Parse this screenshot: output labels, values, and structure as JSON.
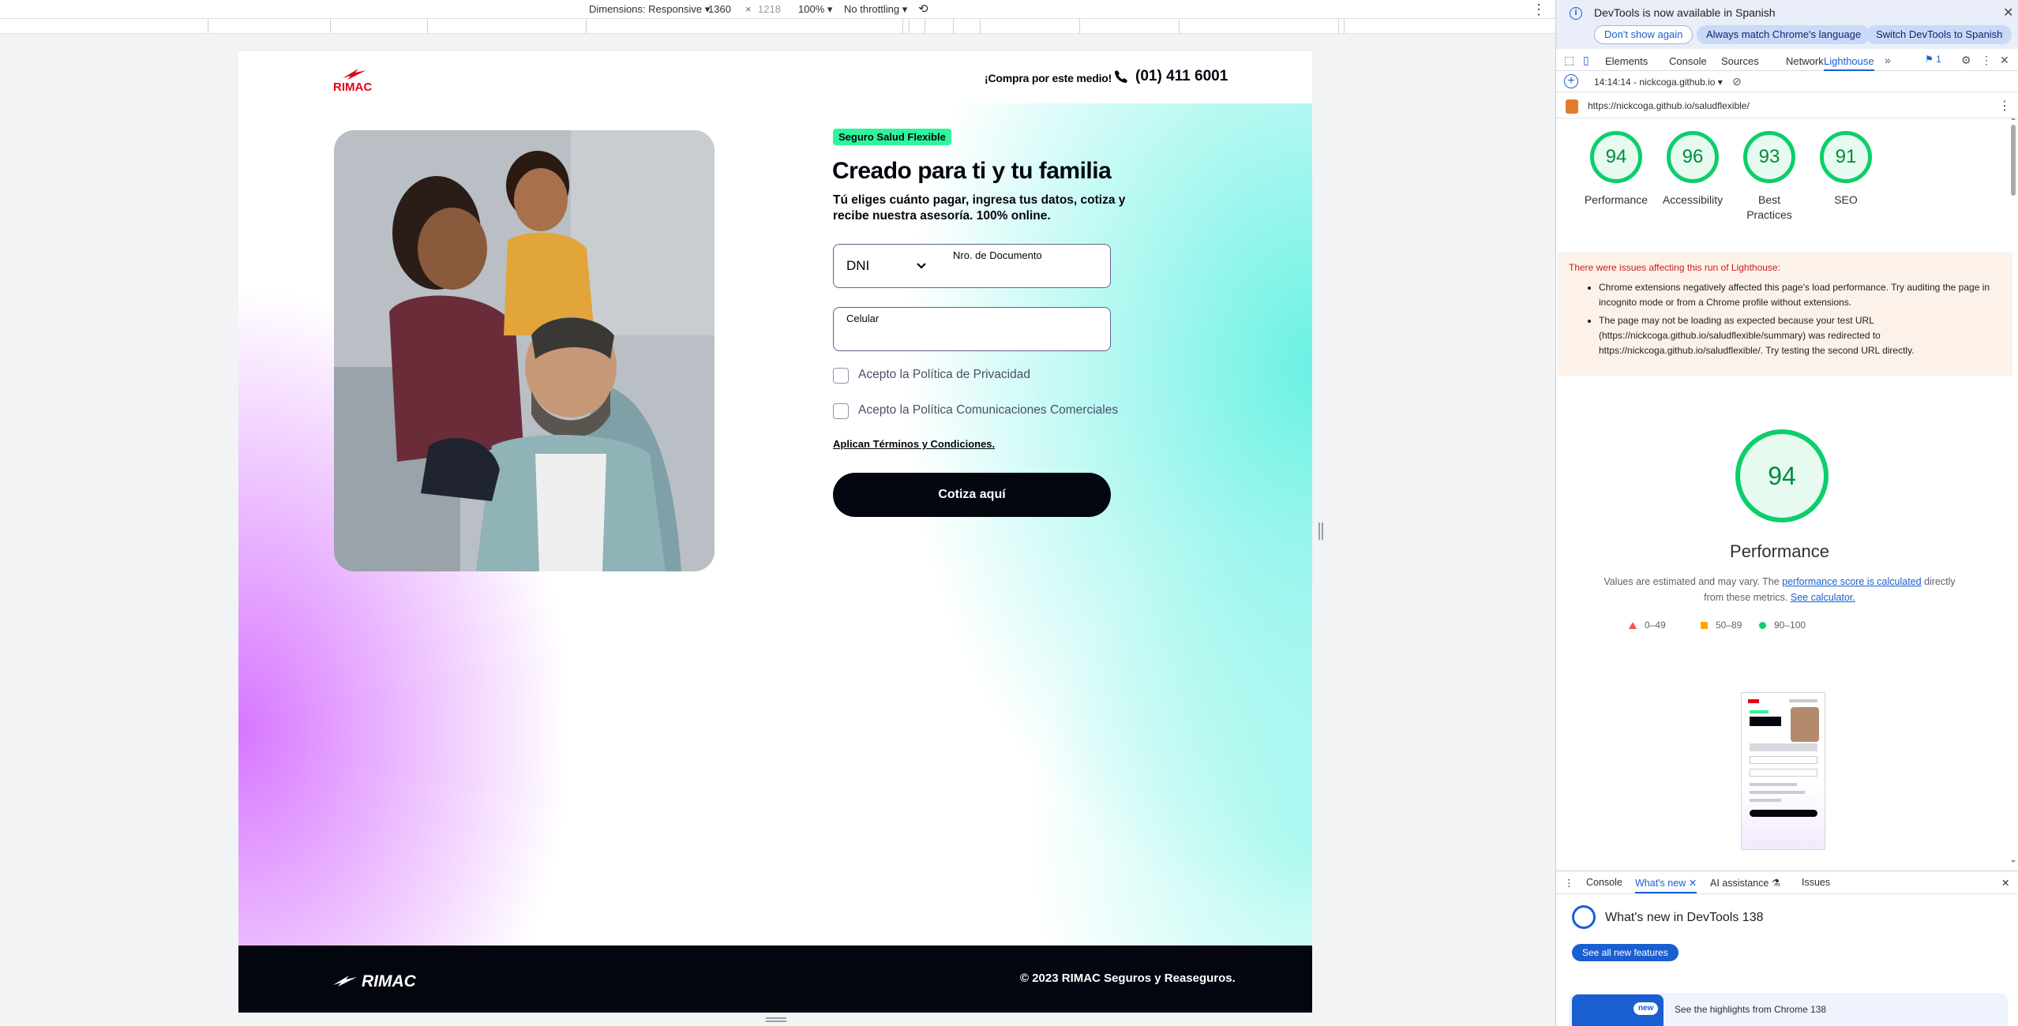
{
  "emulation": {
    "dimensions_label": "Dimensions: Responsive",
    "width": "1360",
    "times": "×",
    "height": "1218",
    "zoom": "100%",
    "throttling": "No throttling"
  },
  "site": {
    "logo_text": "RIMAC",
    "header_cta": "¡Compra por este medio!",
    "phone": "(01) 411 6001",
    "badge": "Seguro Salud Flexible",
    "title": "Creado para ti y tu familia",
    "subtitle": "Tú eliges cuánto pagar, ingresa tus datos, cotiza y recibe nuestra asesoría. 100% online.",
    "doc_type": "DNI",
    "doc_label": "Nro. de Documento",
    "cel_label": "Celular",
    "check_privacy": "Acepto la Política de Privacidad",
    "check_comms": "Acepto la Política Comunicaciones Comerciales",
    "terms": "Aplican Términos y Condiciones.",
    "cta": "Cotiza aquí",
    "footer_logo": "RIMAC",
    "footer_copy": "© 2023 RIMAC Seguros y Reaseguros."
  },
  "devtools": {
    "infobar": {
      "text": "DevTools is now available in Spanish",
      "dont_show": "Don't show again",
      "match": "Always match Chrome's language",
      "switch": "Switch DevTools to Spanish"
    },
    "tabs": [
      "Elements",
      "Console",
      "Sources",
      "Network",
      "Lighthouse"
    ],
    "issues_count": "1",
    "lighthouse_run": "14:14:14 - nickcoga.github.io",
    "url": "https://nickcoga.github.io/saludflexible/",
    "scores": [
      {
        "value": "94",
        "label": "Performance"
      },
      {
        "value": "96",
        "label": "Accessibility"
      },
      {
        "value": "93",
        "label": "Best Practices"
      },
      {
        "value": "91",
        "label": "SEO"
      }
    ],
    "issues_title": "There were issues affecting this run of Lighthouse:",
    "issue_1": "Chrome extensions negatively affected this page's load performance. Try auditing the page in incognito mode or from a Chrome profile without extensions.",
    "issue_2": "The page may not be loading as expected because your test URL (https://nickcoga.github.io/saludflexible/summary) was redirected to https://nickcoga.github.io/saludflexible/. Try testing the second URL directly.",
    "perf_score": "94",
    "perf_label": "Performance",
    "perf_note_1": "Values are estimated and may vary. The ",
    "perf_link_1": "performance score is calculated",
    "perf_note_2": " directly from these metrics. ",
    "perf_link_2": "See calculator.",
    "legend": [
      "0–49",
      "50–89",
      "90–100"
    ],
    "colors": {
      "fail": "#ff4e42",
      "average": "#ffa400",
      "pass": "#0cce6b"
    },
    "drawer_tabs": [
      "Console",
      "What's new",
      "AI assistance",
      "Issues"
    ],
    "whats_new_title": "What's new in DevTools 138",
    "whats_new_button": "See all new features",
    "card_badge": "new",
    "card_text": "See the highlights from Chrome 138"
  }
}
